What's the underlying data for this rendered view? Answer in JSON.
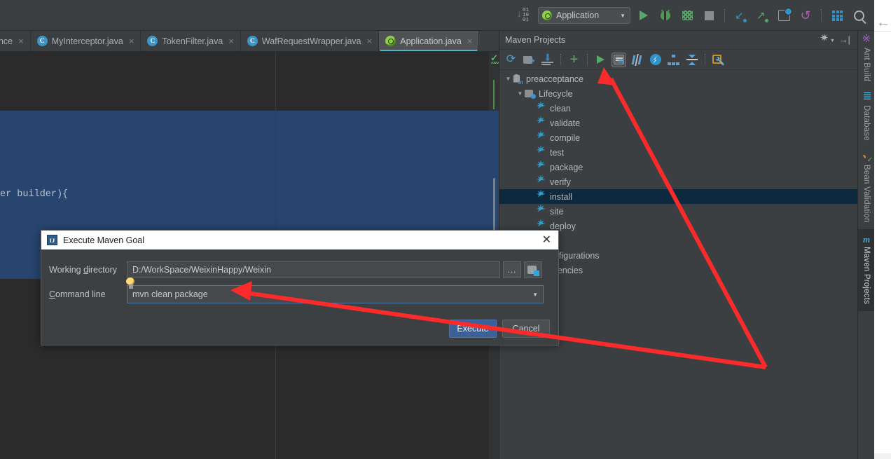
{
  "app": {
    "accent": "#3592c4",
    "selection_blue": "#27456f",
    "tree_selection": "#0d293e",
    "annotation_color": "#fb2b2b"
  },
  "toolbar": {
    "binary_icon": "show-binary-icon",
    "run_config": {
      "label": "Application",
      "icon": "spring-boot-icon",
      "chevron": "▼"
    },
    "buttons": [
      {
        "name": "run-button",
        "icon": "play-icon"
      },
      {
        "name": "debug-button",
        "icon": "bug-icon"
      },
      {
        "name": "run-with-coverage-button",
        "icon": "coverage-icon"
      },
      {
        "name": "stop-button",
        "icon": "stop-icon"
      },
      {
        "name": "update-project-button",
        "icon": "vcs-update-icon"
      },
      {
        "name": "commit-button",
        "icon": "vcs-commit-icon"
      },
      {
        "name": "history-button",
        "icon": "vcs-history-icon"
      },
      {
        "name": "rollback-button",
        "icon": "vcs-rollback-icon"
      },
      {
        "name": "database-button",
        "icon": "grid-icon"
      },
      {
        "name": "search-everywhere-button",
        "icon": "search-icon"
      }
    ]
  },
  "editor_tabs": [
    {
      "label": "ance",
      "icon": "none",
      "truncated": true,
      "active": false
    },
    {
      "label": "MyInterceptor.java",
      "icon": "java-class-icon",
      "active": false
    },
    {
      "label": "TokenFilter.java",
      "icon": "java-class-icon",
      "active": false
    },
    {
      "label": "WafRequestWrapper.java",
      "icon": "java-class-icon",
      "active": false
    },
    {
      "label": "Application.java",
      "icon": "spring-boot-class-icon",
      "active": true
    }
  ],
  "editor": {
    "code_line": "er builder){",
    "inspection_status": "ok-check-icon",
    "has_selection": true
  },
  "maven_panel": {
    "title": "Maven Projects",
    "header_buttons": [
      {
        "name": "panel-settings-button",
        "icon": "gear-icon"
      },
      {
        "name": "panel-hide-button",
        "icon": "hide-icon"
      }
    ],
    "toolbar": [
      {
        "name": "reimport-button",
        "icon": "reimport-icon"
      },
      {
        "name": "generate-sources-button",
        "icon": "generate-sources-icon"
      },
      {
        "name": "download-sources-button",
        "icon": "download-icon"
      },
      {
        "name": "add-maven-project-button",
        "icon": "plus-icon"
      },
      {
        "name": "run-build-button",
        "icon": "play-icon"
      },
      {
        "name": "execute-maven-goal-button",
        "icon": "maven-goal-icon",
        "active": true
      },
      {
        "name": "toggle-skip-tests-button",
        "icon": "skip-tests-icon"
      },
      {
        "name": "toggle-offline-mode-button",
        "icon": "offline-mode-icon"
      },
      {
        "name": "show-dependencies-button",
        "icon": "dependency-tree-icon"
      },
      {
        "name": "collapse-all-button",
        "icon": "collapse-all-icon"
      },
      {
        "name": "maven-settings-button",
        "icon": "maven-settings-icon"
      }
    ],
    "tree": [
      {
        "label": "preacceptance",
        "depth": 0,
        "twisty": "▼",
        "icon": "maven-module-icon",
        "selected": false
      },
      {
        "label": "Lifecycle",
        "depth": 1,
        "twisty": "▼",
        "icon": "folder-icon",
        "selected": false
      },
      {
        "label": "clean",
        "depth": 2,
        "twisty": "",
        "icon": "goal-gear-icon",
        "selected": false
      },
      {
        "label": "validate",
        "depth": 2,
        "twisty": "",
        "icon": "goal-gear-icon",
        "selected": false
      },
      {
        "label": "compile",
        "depth": 2,
        "twisty": "",
        "icon": "goal-gear-icon",
        "selected": false
      },
      {
        "label": "test",
        "depth": 2,
        "twisty": "",
        "icon": "goal-gear-icon",
        "selected": false
      },
      {
        "label": "package",
        "depth": 2,
        "twisty": "",
        "icon": "goal-gear-icon",
        "selected": false
      },
      {
        "label": "verify",
        "depth": 2,
        "twisty": "",
        "icon": "goal-gear-icon",
        "selected": false
      },
      {
        "label": "install",
        "depth": 2,
        "twisty": "",
        "icon": "goal-gear-icon",
        "selected": true
      },
      {
        "label": "site",
        "depth": 2,
        "twisty": "",
        "icon": "goal-gear-icon",
        "selected": false
      },
      {
        "label": "deploy",
        "depth": 2,
        "twisty": "",
        "icon": "goal-gear-icon",
        "selected": false
      },
      {
        "label": "ns",
        "depth": 1,
        "twisty": "",
        "icon": "none",
        "selected": false,
        "occluded": true
      },
      {
        "label": "Configurations",
        "depth": 1,
        "twisty": "",
        "icon": "none",
        "selected": false,
        "occluded": true
      },
      {
        "label": "endencies",
        "depth": 1,
        "twisty": "",
        "icon": "none",
        "selected": false,
        "occluded": true
      }
    ]
  },
  "right_tool_bar": [
    {
      "label": "Ant Build",
      "icon": "ant-icon",
      "active": false
    },
    {
      "label": "Database",
      "icon": "database-icon",
      "active": false
    },
    {
      "label": "Bean Validation",
      "icon": "bean-validation-icon",
      "active": false
    },
    {
      "label": "Maven Projects",
      "icon": "maven-m-icon",
      "active": true
    }
  ],
  "browser_strip": {
    "back_icon": "back-arrow-icon"
  },
  "dialog": {
    "title": "Execute Maven Goal",
    "title_icon": "intellij-idea-icon",
    "close_icon": "close-icon",
    "working_directory": {
      "label_pre": "Working ",
      "label_mnemonic": "d",
      "label_post": "irectory",
      "value": "D:/WorkSpace/WeixinHappy/Weixin",
      "browse_label": "...",
      "browse_icon": "folder-icon"
    },
    "command_line": {
      "label_mnemonic": "C",
      "label_post": "ommand line",
      "value": "mvn clean package",
      "placeholder": "mvn clean package",
      "dropdown_icon": "chevron-down-icon",
      "hint_icon": "lightbulb-icon"
    },
    "buttons": {
      "execute": "Execute",
      "cancel": "Cancel"
    }
  }
}
